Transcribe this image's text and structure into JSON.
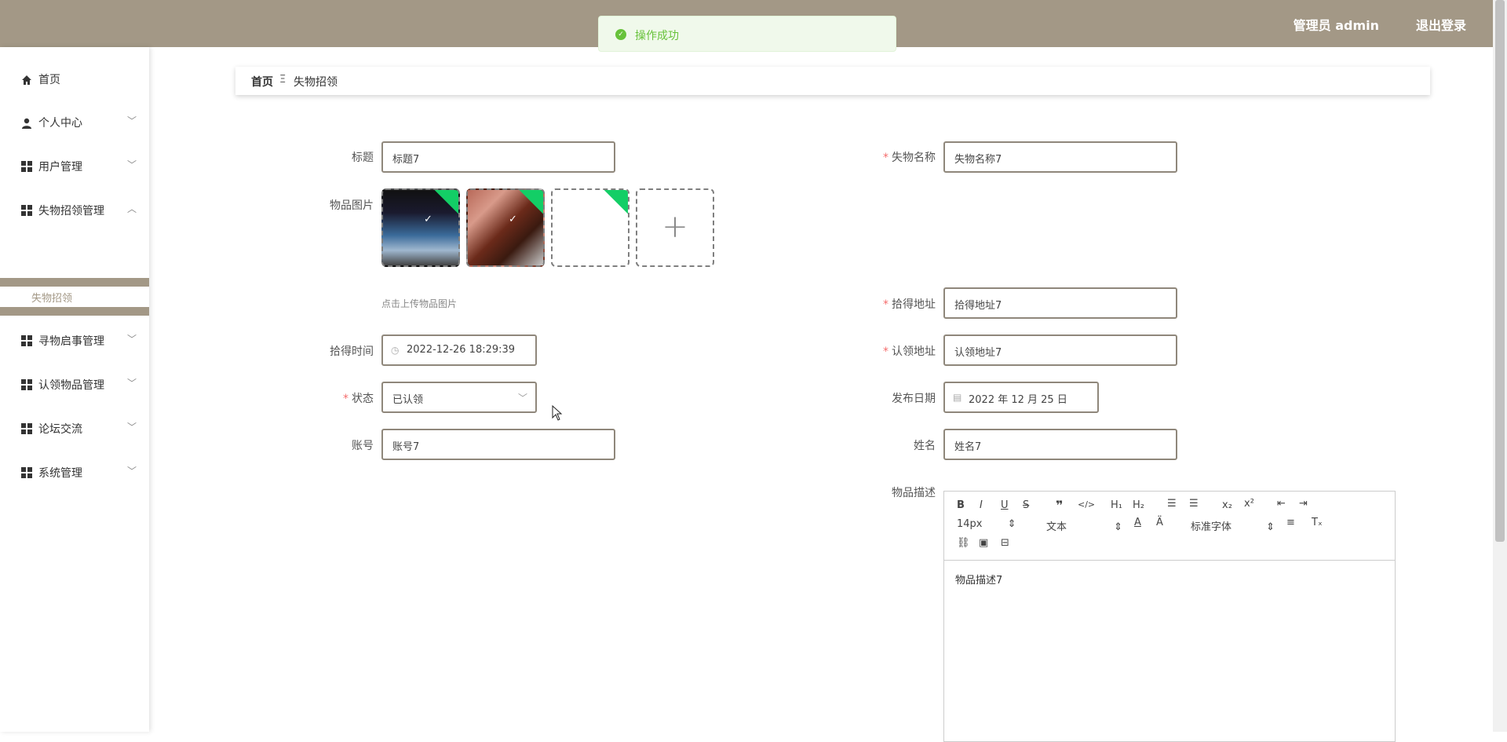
{
  "header": {
    "user_label": "管理员 admin",
    "logout_label": "退出登录"
  },
  "toast": {
    "message": "操作成功"
  },
  "sidebar": {
    "items": [
      {
        "label": "首页"
      },
      {
        "label": "个人中心"
      },
      {
        "label": "用户管理"
      },
      {
        "label": "失物招领管理"
      },
      {
        "label": "寻物启事管理"
      },
      {
        "label": "认领物品管理"
      },
      {
        "label": "论坛交流"
      },
      {
        "label": "系统管理"
      }
    ],
    "sub_item": "失物招领"
  },
  "breadcrumb": {
    "home": "首页",
    "current": "失物招领"
  },
  "form": {
    "title_label": "标题",
    "title_value": "标题7",
    "name_label": "失物名称",
    "name_value": "失物名称7",
    "images_label": "物品图片",
    "upload_hint": "点击上传物品图片",
    "found_addr_label": "拾得地址",
    "found_addr_value": "拾得地址7",
    "found_time_label": "拾得时间",
    "found_time_value": "2022-12-26 18:29:39",
    "claim_addr_label": "认领地址",
    "claim_addr_value": "认领地址7",
    "status_label": "状态",
    "status_value": "已认领",
    "publish_label": "发布日期",
    "publish_value": "2022 年 12 月 25 日",
    "account_label": "账号",
    "account_value": "账号7",
    "realname_label": "姓名",
    "realname_value": "姓名7",
    "desc_label": "物品描述",
    "desc_value": "物品描述7"
  },
  "editor": {
    "font_size": "14px",
    "block_format": "文本",
    "font_family": "标准字体"
  },
  "colors": {
    "header": "#a39886",
    "success": "#67c23a",
    "corner": "#13ce66"
  }
}
